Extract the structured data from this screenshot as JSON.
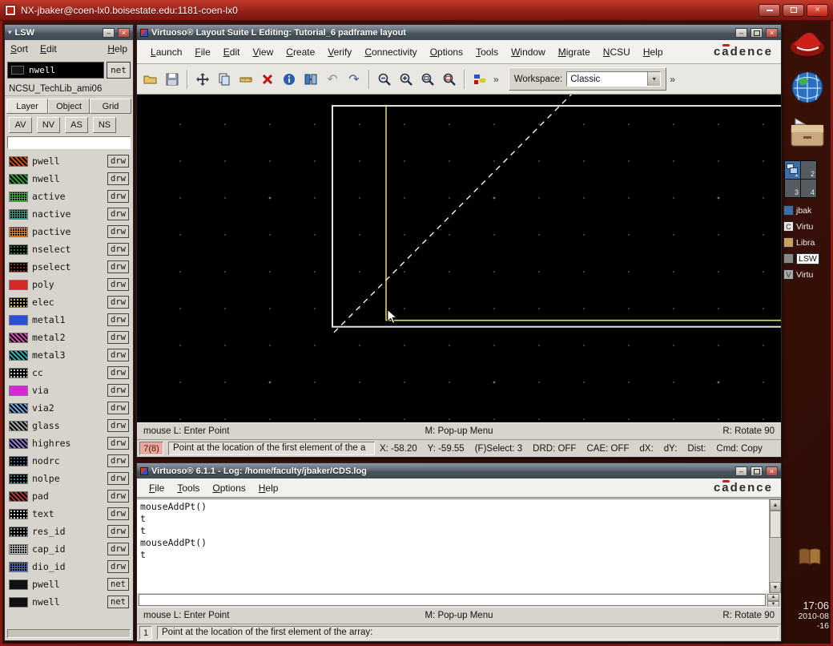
{
  "nx": {
    "title": "NX-jbaker@coen-lx0.boisestate.edu:1181-coen-lx0"
  },
  "icons": {
    "minimize": "–",
    "close": "×",
    "overflow": "»",
    "dropdown": "▾",
    "scroll_up": "▲",
    "scroll_down": "▼",
    "chevron": "▾"
  },
  "lsw": {
    "title": "LSW",
    "menu": [
      "Sort",
      "Edit",
      "Help"
    ],
    "current_layer": {
      "name": "nwell",
      "purpose": "net"
    },
    "tech_lib": "NCSU_TechLib_ami06",
    "tabs": [
      "Layer",
      "Object",
      "Grid"
    ],
    "visibility_buttons": [
      "AV",
      "NV",
      "AS",
      "NS"
    ],
    "filter_value": "",
    "layers": [
      {
        "name": "pwell",
        "purpose": "drw",
        "color": "#d4500f",
        "pattern": "hatch"
      },
      {
        "name": "nwell",
        "purpose": "drw",
        "color": "#2f9e2f",
        "pattern": "hatch"
      },
      {
        "name": "active",
        "purpose": "drw",
        "color": "#39b539",
        "pattern": "cross"
      },
      {
        "name": "nactive",
        "purpose": "drw",
        "color": "#2f9e8e",
        "pattern": "cross"
      },
      {
        "name": "pactive",
        "purpose": "drw",
        "color": "#e08a1e",
        "pattern": "cross"
      },
      {
        "name": "nselect",
        "purpose": "drw",
        "color": "#1e7a1e",
        "pattern": "dots"
      },
      {
        "name": "pselect",
        "purpose": "drw",
        "color": "#8e1e1e",
        "pattern": "dots"
      },
      {
        "name": "poly",
        "purpose": "drw",
        "color": "#d42a2a",
        "pattern": "solid"
      },
      {
        "name": "elec",
        "purpose": "drw",
        "color": "#e0c81e",
        "pattern": "dots"
      },
      {
        "name": "metal1",
        "purpose": "drw",
        "color": "#2a50d4",
        "pattern": "solid"
      },
      {
        "name": "metal2",
        "purpose": "drw",
        "color": "#d44fb4",
        "pattern": "hatch"
      },
      {
        "name": "metal3",
        "purpose": "drw",
        "color": "#2ab4b4",
        "pattern": "hatch"
      },
      {
        "name": "cc",
        "purpose": "drw",
        "color": "#cfcfcf",
        "pattern": "dots"
      },
      {
        "name": "via",
        "purpose": "drw",
        "color": "#d42ad4",
        "pattern": "solid"
      },
      {
        "name": "via2",
        "purpose": "drw",
        "color": "#6fa8e0",
        "pattern": "hatch"
      },
      {
        "name": "glass",
        "purpose": "drw",
        "color": "#a8a8a8",
        "pattern": "hatch"
      },
      {
        "name": "highres",
        "purpose": "drw",
        "color": "#9a7ad4",
        "pattern": "hatch"
      },
      {
        "name": "nodrc",
        "purpose": "drw",
        "color": "#3a5a8e",
        "pattern": "dots"
      },
      {
        "name": "nolpe",
        "purpose": "drw",
        "color": "#3a8e8e",
        "pattern": "dots"
      },
      {
        "name": "pad",
        "purpose": "drw",
        "color": "#b03a3a",
        "pattern": "hatch"
      },
      {
        "name": "text",
        "purpose": "drw",
        "color": "#d8d8d8",
        "pattern": "dots"
      },
      {
        "name": "res_id",
        "purpose": "drw",
        "color": "#9e9e9e",
        "pattern": "dots"
      },
      {
        "name": "cap_id",
        "purpose": "drw",
        "color": "#bcbcbc",
        "pattern": "cross"
      },
      {
        "name": "dio_id",
        "purpose": "drw",
        "color": "#4a6ab0",
        "pattern": "cross"
      },
      {
        "name": "pwell",
        "purpose": "net",
        "color": "#101010",
        "pattern": "solid"
      },
      {
        "name": "nwell",
        "purpose": "net",
        "color": "#101010",
        "pattern": "solid"
      }
    ]
  },
  "main": {
    "title": "Virtuoso® Layout Suite L Editing: Tutorial_6 padframe layout",
    "menu": [
      "Launch",
      "File",
      "Edit",
      "View",
      "Create",
      "Verify",
      "Connectivity",
      "Options",
      "Tools",
      "Window",
      "Migrate",
      "NCSU",
      "Help"
    ],
    "brand": "cadence",
    "toolbar": {
      "workspace_label": "Workspace:",
      "workspace_value": "Classic"
    },
    "status": {
      "left": "mouse L: Enter Point",
      "middle": "M: Pop-up Menu",
      "right": "R: Rotate 90"
    },
    "prompt": {
      "badge": "7(8)",
      "text": "Point at the location of the first element of the a",
      "fields": [
        "X: -58.20",
        "Y: -59.55",
        "(F)Select: 3",
        "DRD: OFF",
        "CAE: OFF",
        "dX:",
        "dY:",
        "Dist:",
        "Cmd: Copy"
      ]
    }
  },
  "log": {
    "title": "Virtuoso® 6.1.1 - Log: /home/faculty/jbaker/CDS.log",
    "menu": [
      "File",
      "Tools",
      "Options",
      "Help"
    ],
    "brand": "cadence",
    "lines": [
      "mouseAddPt()",
      "t",
      "t",
      "mouseAddPt()",
      "t"
    ],
    "input_value": "",
    "status": {
      "left": "mouse L: Enter Point",
      "middle": "M: Pop-up Menu",
      "right": "R: Rotate 90"
    },
    "prompt": {
      "badge": "1",
      "text": "Point at the location of the first element of the array:"
    }
  },
  "side": {
    "pager": [
      "1",
      "2",
      "3",
      "4"
    ],
    "tasks": [
      {
        "label": "jbak",
        "glyph": "",
        "icon": "terminal-icon",
        "color": "#3b6ea5",
        "boxed": false
      },
      {
        "label": "Virtu",
        "glyph": "C",
        "icon": "virtuoso-icon",
        "color": "#e4e4e4",
        "boxed": false
      },
      {
        "label": "Libra",
        "glyph": "",
        "icon": "library-manager-icon",
        "color": "#c8a060",
        "boxed": false
      },
      {
        "label": "LSW",
        "glyph": "",
        "icon": "lsw-icon",
        "color": "#888888",
        "boxed": true
      },
      {
        "label": "Virtu",
        "glyph": "V",
        "icon": "virtuoso-icon",
        "color": "#a8a8a8",
        "boxed": false
      }
    ],
    "clock": {
      "time": "17:06",
      "date_line1": "2010-08",
      "date_line2": "-16"
    }
  }
}
